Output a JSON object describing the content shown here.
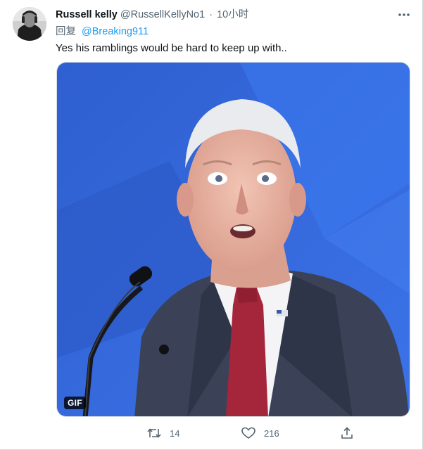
{
  "tweet": {
    "author_name": "Russell kelly",
    "author_handle": "@RussellKellyNo1",
    "separator": "·",
    "timestamp": "10小时",
    "reply_prefix": "回复",
    "reply_to": "@Breaking911",
    "text": "Yes his ramblings would be hard to keep up with..",
    "media_badge": "GIF"
  },
  "actions": {
    "retweet_count": "14",
    "like_count": "216"
  },
  "icons": {
    "more": "more-horizontal-icon",
    "retweet": "retweet-icon",
    "like": "heart-icon",
    "share": "share-icon"
  },
  "colors": {
    "link": "#1d9bf0",
    "secondary_text": "#536471",
    "primary_text": "#0f1419",
    "media_background": "#2f64d6"
  }
}
